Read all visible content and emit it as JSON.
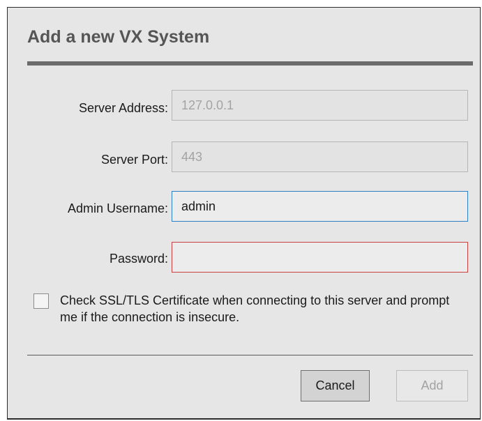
{
  "dialog": {
    "title": "Add a new VX System",
    "fields": {
      "server_address": {
        "label": "Server Address:",
        "value": "127.0.0.1",
        "disabled": true
      },
      "server_port": {
        "label": "Server Port:",
        "value": "443",
        "disabled": true
      },
      "admin_username": {
        "label": "Admin Username:",
        "value": "admin",
        "state": "focused"
      },
      "password": {
        "label": "Password:",
        "value": "",
        "state": "invalid"
      }
    },
    "ssl_check": {
      "label": "Check SSL/TLS Certificate when connecting to this server and prompt me if the connection is insecure.",
      "checked": false
    },
    "buttons": {
      "cancel": "Cancel",
      "add": "Add",
      "add_disabled": true
    }
  },
  "colors": {
    "dialog_background": "#e6e6e6",
    "focus_border": "#2f7ec1",
    "error_border": "#c94040",
    "disabled_text": "#a3a3a3"
  }
}
